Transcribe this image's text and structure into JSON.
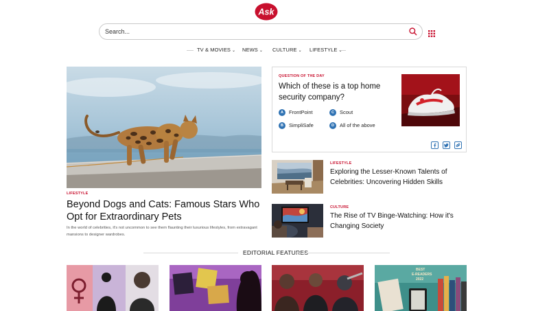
{
  "brand": {
    "logo_text": "Ask",
    "accent": "#c8102e",
    "link_blue": "#2f72b3"
  },
  "search": {
    "placeholder": "Search...",
    "icon": "search-icon",
    "grid_icon": "apps-grid-icon"
  },
  "nav": {
    "items": [
      {
        "label": "TV & MOVIES"
      },
      {
        "label": "NEWS"
      },
      {
        "label": "CULTURE"
      },
      {
        "label": "LIFESTYLE"
      }
    ],
    "chevron": "chevron-down-icon"
  },
  "hero": {
    "kicker": "LIFESTYLE",
    "title": "Beyond Dogs and Cats: Famous Stars Who Opt for Extraordinary Pets",
    "description": "In the world of celebrities, it's not uncommon to see them flaunting their luxurious lifestyles, from extravagant mansions to designer wardrobes."
  },
  "question": {
    "kicker": "QUESTION OF THE DAY",
    "title": "Which of these is a top home security company?",
    "options": [
      {
        "letter": "A",
        "text": "FrontPoint"
      },
      {
        "letter": "C",
        "text": "Scout"
      },
      {
        "letter": "B",
        "text": "SimpliSafe"
      },
      {
        "letter": "D",
        "text": "All of the above"
      }
    ],
    "share_icons": [
      "facebook-icon",
      "twitter-icon",
      "link-icon"
    ]
  },
  "side_articles": [
    {
      "kicker": "LIFESTYLE",
      "title": "Exploring the Lesser-Known Talents of Celebrities: Uncovering Hidden Skills"
    },
    {
      "kicker": "CULTURE",
      "title": "The Rise of TV Binge-Watching: How it's Changing Society"
    }
  ],
  "editorial": {
    "heading": "EDITORIAL FEATURES"
  }
}
